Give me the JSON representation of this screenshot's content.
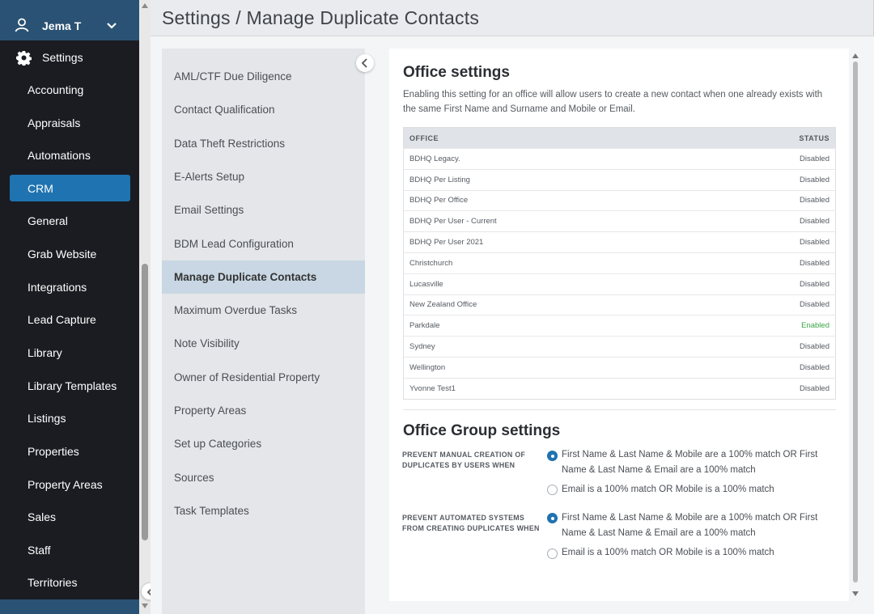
{
  "user": {
    "name": "Jema T"
  },
  "sidebar": {
    "settings_label": "Settings",
    "items": [
      {
        "label": "Accounting",
        "active": false
      },
      {
        "label": "Appraisals",
        "active": false
      },
      {
        "label": "Automations",
        "active": false
      },
      {
        "label": "CRM",
        "active": true
      },
      {
        "label": "General",
        "active": false
      },
      {
        "label": "Grab Website",
        "active": false
      },
      {
        "label": "Integrations",
        "active": false
      },
      {
        "label": "Lead Capture",
        "active": false
      },
      {
        "label": "Library",
        "active": false
      },
      {
        "label": "Library Templates",
        "active": false
      },
      {
        "label": "Listings",
        "active": false
      },
      {
        "label": "Properties",
        "active": false
      },
      {
        "label": "Property Areas",
        "active": false
      },
      {
        "label": "Sales",
        "active": false
      },
      {
        "label": "Staff",
        "active": false
      },
      {
        "label": "Territories",
        "active": false
      }
    ]
  },
  "page": {
    "title": "Settings / Manage Duplicate Contacts"
  },
  "settings_nav": {
    "items": [
      {
        "label": "AML/CTF Due Diligence",
        "active": false
      },
      {
        "label": "Contact Qualification",
        "active": false
      },
      {
        "label": "Data Theft Restrictions",
        "active": false
      },
      {
        "label": "E-Alerts Setup",
        "active": false
      },
      {
        "label": "Email Settings",
        "active": false
      },
      {
        "label": "BDM Lead Configuration",
        "active": false
      },
      {
        "label": "Manage Duplicate Contacts",
        "active": true
      },
      {
        "label": "Maximum Overdue Tasks",
        "active": false
      },
      {
        "label": "Note Visibility",
        "active": false
      },
      {
        "label": "Owner of Residential Property",
        "active": false
      },
      {
        "label": "Property Areas",
        "active": false
      },
      {
        "label": "Set up Categories",
        "active": false
      },
      {
        "label": "Sources",
        "active": false
      },
      {
        "label": "Task Templates",
        "active": false
      }
    ]
  },
  "office_settings": {
    "heading": "Office settings",
    "description": "Enabling this setting for an office will allow users to create a new contact when one already exists with the same First Name and Surname and Mobile or Email.",
    "columns": {
      "office": "OFFICE",
      "status": "STATUS"
    },
    "rows": [
      {
        "office": "BDHQ Legacy.",
        "status": "Disabled"
      },
      {
        "office": "BDHQ Per Listing",
        "status": "Disabled"
      },
      {
        "office": "BDHQ Per Office",
        "status": "Disabled"
      },
      {
        "office": "BDHQ Per User - Current",
        "status": "Disabled"
      },
      {
        "office": "BDHQ Per User 2021",
        "status": "Disabled"
      },
      {
        "office": "Christchurch",
        "status": "Disabled"
      },
      {
        "office": "Lucasville",
        "status": "Disabled"
      },
      {
        "office": "New Zealand Office",
        "status": "Disabled"
      },
      {
        "office": "Parkdale",
        "status": "Enabled"
      },
      {
        "office": "Sydney",
        "status": "Disabled"
      },
      {
        "office": "Wellington",
        "status": "Disabled"
      },
      {
        "office": "Yvonne Test1",
        "status": "Disabled"
      }
    ]
  },
  "group_settings": {
    "heading": "Office Group settings",
    "groups": [
      {
        "label": "PREVENT MANUAL CREATION OF DUPLICATES BY USERS WHEN",
        "options": [
          {
            "label": "First Name & Last Name & Mobile are a 100% match OR First Name & Last Name & Email are a 100% match",
            "selected": true
          },
          {
            "label": "Email is a 100% match OR Mobile is a 100% match",
            "selected": false
          }
        ]
      },
      {
        "label": "PREVENT AUTOMATED SYSTEMS FROM CREATING DUPLICATES WHEN",
        "options": [
          {
            "label": "First Name & Last Name & Mobile are a 100% match OR First Name & Last Name & Email are a 100% match",
            "selected": true
          },
          {
            "label": "Email is a 100% match OR Mobile is a 100% match",
            "selected": false
          }
        ]
      }
    ]
  },
  "colors": {
    "sidebar_bg": "#1a1c22",
    "accent": "#1f73b0",
    "enabled_status": "#3aa545",
    "active_nav_bg": "#c8d7e3"
  }
}
